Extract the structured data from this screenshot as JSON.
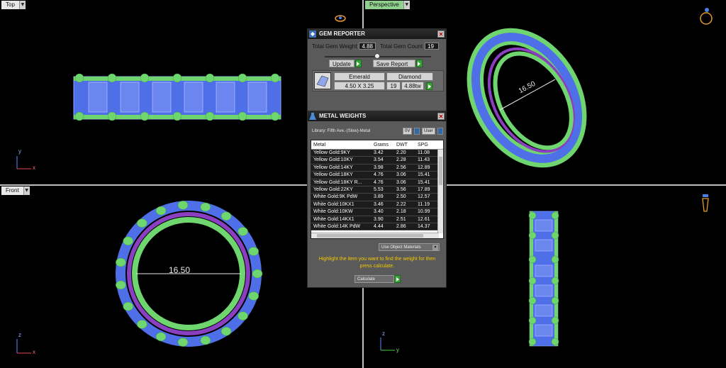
{
  "viewports": {
    "top": {
      "label": "Top",
      "axis_v": "y",
      "axis_h": "x"
    },
    "perspective": {
      "label": "Perspective"
    },
    "front": {
      "label": "Front",
      "axis_v": "z",
      "axis_h": "x",
      "dimension": "16.50"
    },
    "right": {
      "axis_v": "z",
      "axis_h": "y"
    },
    "perspective_dimension": "16.50"
  },
  "gem_reporter": {
    "title": "GEM REPORTER",
    "total_weight_label": "Total Gem Weight",
    "total_weight_value": "4.88",
    "total_count_label": "Total Gem Count",
    "total_count_value": "19",
    "update_label": "Update",
    "save_report_label": "Save Report",
    "gem": {
      "shape": "Emerald",
      "size": "4.50 X 3.25",
      "type": "Diamond",
      "count": "19",
      "weight": "4.88tw"
    }
  },
  "metal_weights": {
    "title": "METAL WEIGHTS",
    "library": "Library: Fifth Ave.-(Slow)-Metal",
    "toggle_1": "0V",
    "toggle_2": "User",
    "columns": [
      "Metal",
      "Grams",
      "DWT",
      "SPG"
    ],
    "rows": [
      {
        "metal": "Yellow Gold:9KY",
        "grams": "3.42",
        "dwt": "2.20",
        "spg": "11.08"
      },
      {
        "metal": "Yellow Gold:10KY",
        "grams": "3.54",
        "dwt": "2.28",
        "spg": "11.43"
      },
      {
        "metal": "Yellow Gold:14KY",
        "grams": "3.98",
        "dwt": "2.56",
        "spg": "12.89"
      },
      {
        "metal": "Yellow Gold:18KY",
        "grams": "4.76",
        "dwt": "3.06",
        "spg": "15.41"
      },
      {
        "metal": "Yellow Gold:18KY R...",
        "grams": "4.76",
        "dwt": "3.06",
        "spg": "15.41"
      },
      {
        "metal": "Yellow Gold:22KY",
        "grams": "5.53",
        "dwt": "3.56",
        "spg": "17.89"
      },
      {
        "metal": "White Gold:9K PdW",
        "grams": "3.89",
        "dwt": "2.50",
        "spg": "12.57"
      },
      {
        "metal": "White Gold:10KX1",
        "grams": "3.46",
        "dwt": "2.22",
        "spg": "11.19"
      },
      {
        "metal": "White Gold:10KW",
        "grams": "3.40",
        "dwt": "2.18",
        "spg": "10.99"
      },
      {
        "metal": "White Gold:14KX1",
        "grams": "3.90",
        "dwt": "2.51",
        "spg": "12.61"
      },
      {
        "metal": "White Gold:14K PdW",
        "grams": "4.44",
        "dwt": "2.86",
        "spg": "14.37"
      }
    ],
    "material_mode": "Use Object Materials",
    "hint": "Highlight the item you want to find the weight for then press calculate.",
    "calculate_label": "Calculate"
  },
  "colors": {
    "prong_green": "#6fd66f",
    "band_blue": "#4f6fe8",
    "band_purple": "#8a3fc0",
    "hint_yellow": "#f5c800"
  }
}
